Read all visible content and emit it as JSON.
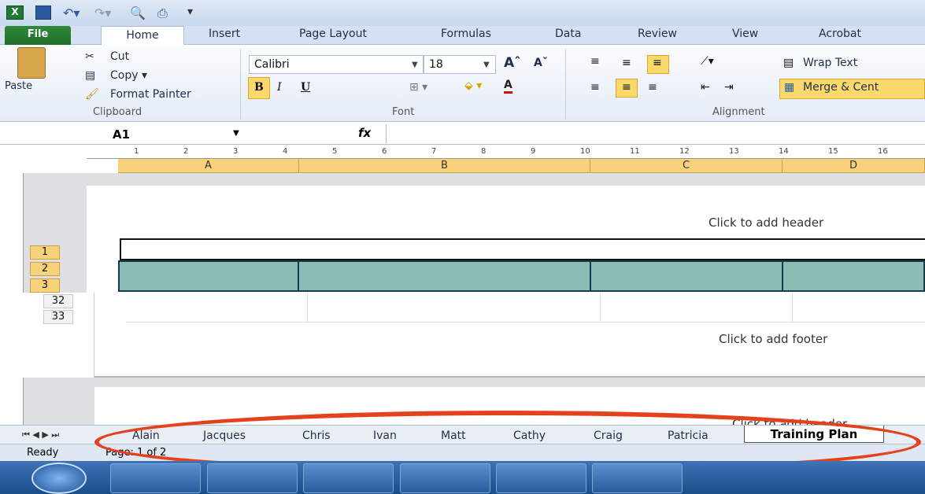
{
  "ribbon": {
    "tabs": [
      "File",
      "Home",
      "Insert",
      "Page Layout",
      "Formulas",
      "Data",
      "Review",
      "View",
      "Acrobat"
    ],
    "clipboard": {
      "paste": "Paste",
      "cut": "Cut",
      "copy": "Copy ▾",
      "format_painter": "Format Painter",
      "group": "Clipboard"
    },
    "font": {
      "name": "Calibri",
      "size": "18",
      "group": "Font",
      "bold": "B",
      "italic": "I",
      "underline": "U"
    },
    "alignment": {
      "wrap": "Wrap Text",
      "merge": "Merge & Cent",
      "group": "Alignment"
    }
  },
  "formula_bar": {
    "namebox": "A1",
    "fx": "fx"
  },
  "columns": [
    "A",
    "B",
    "C",
    "D"
  ],
  "ruler_numbers": [
    "1",
    "2",
    "3",
    "4",
    "5",
    "6",
    "7",
    "8",
    "9",
    "10",
    "11",
    "12",
    "13",
    "14",
    "15",
    "16"
  ],
  "rows": {
    "top": [
      "1",
      "2",
      "3"
    ],
    "bottom": [
      "32",
      "33"
    ]
  },
  "page": {
    "header": "Click to add header",
    "footer": "Click to add footer",
    "header2": "Click to add header"
  },
  "sheets": [
    "Alain",
    "Jacques",
    "Chris",
    "Ivan",
    "Matt",
    "Cathy",
    "Craig",
    "Patricia"
  ],
  "active_sheet": "Training Plan",
  "status": {
    "ready": "Ready",
    "page": "Page: 1 of 2"
  },
  "colors": {
    "header_bar": "#8cbcb6",
    "annotation": "#e4421c",
    "accent": "#f7d27a"
  }
}
